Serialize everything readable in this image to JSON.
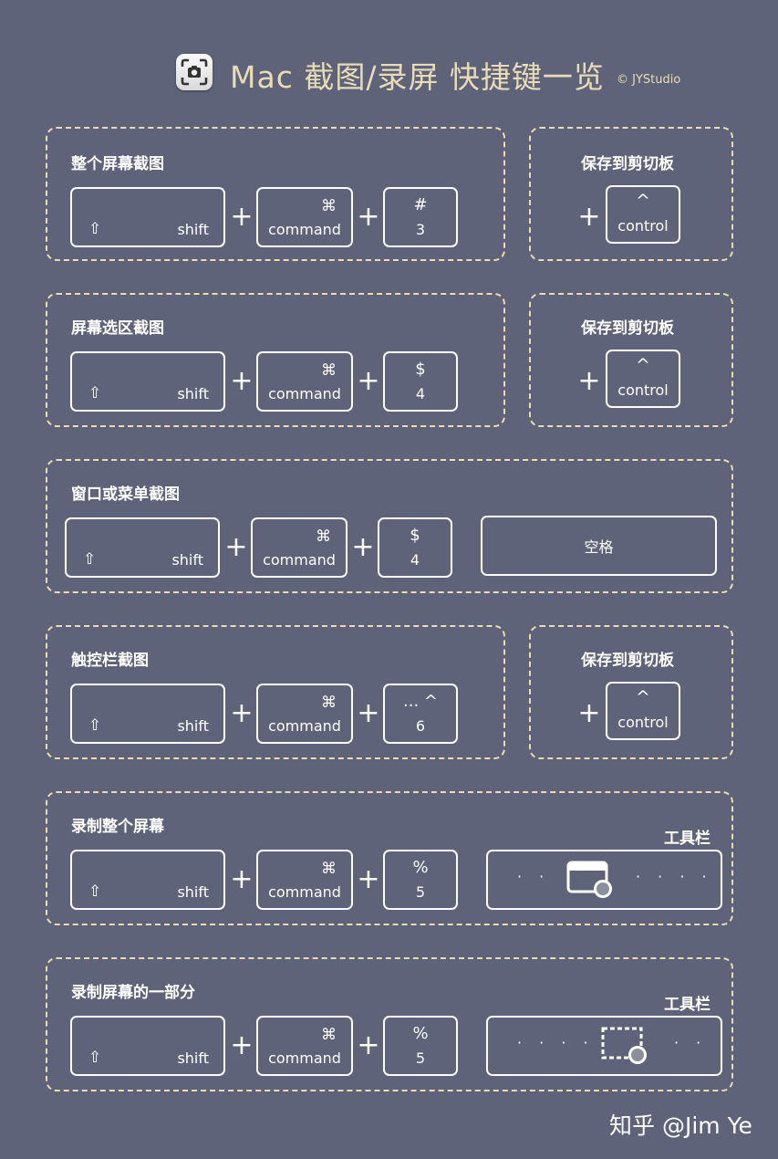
{
  "header": {
    "title": "Mac 截图/录屏 快捷键一览",
    "copyright": "© JYStudio",
    "app_icon": "screenshot-app-icon"
  },
  "keys": {
    "shift_glyph": "⇧",
    "shift_label": "shift",
    "command_glyph": "⌘",
    "command_label": "command",
    "control_glyph": "^",
    "control_label": "control",
    "space_label": "空格",
    "plus": "+"
  },
  "sections": [
    {
      "title": "整个屏幕截图",
      "num_symbol": "#",
      "num_label": "3",
      "clipboard_title": "保存到剪切板"
    },
    {
      "title": "屏幕选区截图",
      "num_symbol": "$",
      "num_label": "4",
      "clipboard_title": "保存到剪切板"
    },
    {
      "title": "窗口或菜单截图",
      "num_symbol": "$",
      "num_label": "4"
    },
    {
      "title": "触控栏截图",
      "num_symbol": "... ^",
      "num_label": "6",
      "clipboard_title": "保存到剪切板"
    },
    {
      "title": "录制整个屏幕",
      "num_symbol": "%",
      "num_label": "5",
      "toolbar_label": "工具栏",
      "toolbar_dots_left": "· ·",
      "toolbar_dots_right": "· · · ·"
    },
    {
      "title": "录制屏幕的一部分",
      "num_symbol": "%",
      "num_label": "5",
      "toolbar_label": "工具栏",
      "toolbar_dots_left": "· · · ·",
      "toolbar_dots_right": "· ·"
    }
  ],
  "watermark": "知乎 @Jim Ye",
  "colors": {
    "background": "#5e6379",
    "accent": "#e7dcb6",
    "dash": "#eadcb4",
    "key_border": "#ffffff"
  }
}
